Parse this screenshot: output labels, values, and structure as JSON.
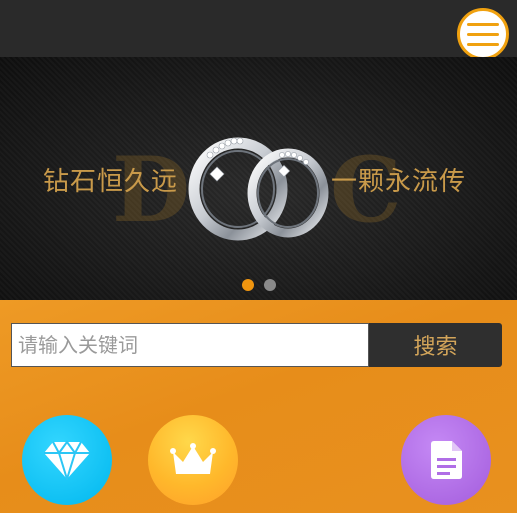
{
  "banner": {
    "slogan_left": "钻石恒久远",
    "slogan_right": "一颗永流传",
    "monogram_left": "D",
    "monogram_right": "C",
    "slides_total": 2,
    "active_slide": 1
  },
  "search": {
    "placeholder": "请输入关键词",
    "button_label": "搜索"
  },
  "quick_links": [
    {
      "icon": "diamond-icon",
      "color": "#00b7ee"
    },
    {
      "icon": "crown-icon",
      "color": "#ffb82b"
    },
    {
      "icon": "document-icon",
      "color": "#a35cdc"
    }
  ],
  "colors": {
    "accent": "#f0a10f",
    "page_bg": "#e8901c",
    "header_bg": "#2a2a2a",
    "gold_text": "#c99a4a"
  }
}
